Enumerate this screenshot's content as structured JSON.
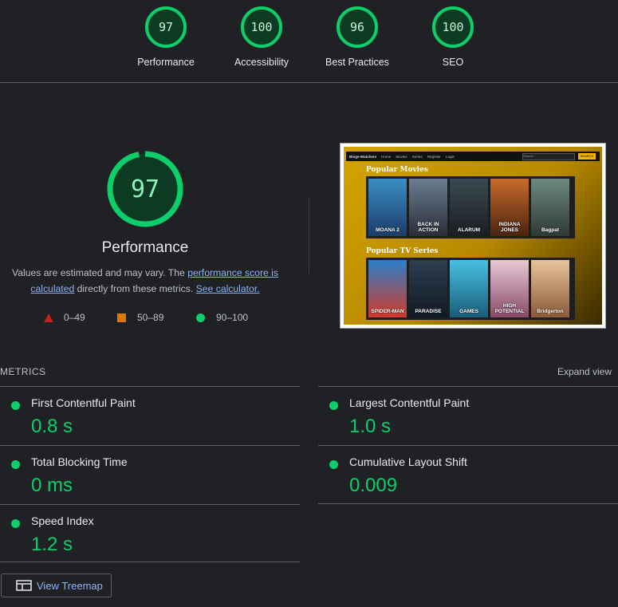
{
  "scores": [
    {
      "value": "97",
      "label": "Performance"
    },
    {
      "value": "100",
      "label": "Accessibility"
    },
    {
      "value": "96",
      "label": "Best Practices"
    },
    {
      "value": "100",
      "label": "SEO"
    }
  ],
  "performance": {
    "score": "97",
    "score_fraction": 0.97,
    "title": "Performance",
    "desc_part1": "Values are estimated and may vary. The ",
    "desc_link1": "performance score is calculated",
    "desc_part2": " directly from these metrics. ",
    "desc_link2": "See calculator."
  },
  "legend": {
    "fail": "0–49",
    "average": "50–89",
    "pass": "90–100"
  },
  "screenshot": {
    "brand": "Binge-Watchers",
    "nav_links": [
      "Home",
      "Movies",
      "Series",
      "Register",
      "Login"
    ],
    "search_placeholder": "Search...",
    "search_button": "SEARCH",
    "movies_heading": "Popular Movies",
    "series_heading": "Popular TV Series",
    "movie_titles": [
      "MOANA 2",
      "BACK IN ACTION",
      "ALARUM",
      "INDIANA JONES",
      "Bagpat"
    ],
    "series_titles": [
      "SPIDER-MAN",
      "PARADISE",
      "GAMES",
      "HIGH POTENTIAL",
      "Bridgerton"
    ]
  },
  "metrics": {
    "section_label": "METRICS",
    "expand_label": "Expand view",
    "fcp": {
      "name": "First Contentful Paint",
      "value": "0.8 s"
    },
    "lcp": {
      "name": "Largest Contentful Paint",
      "value": "1.0 s"
    },
    "tbt": {
      "name": "Total Blocking Time",
      "value": "0 ms"
    },
    "cls": {
      "name": "Cumulative Layout Shift",
      "value": "0.009"
    },
    "si": {
      "name": "Speed Index",
      "value": "1.2 s"
    }
  },
  "treemap_button": "View Treemap",
  "colors": {
    "pass": "#0cce6b",
    "average": "#e37400",
    "fail": "#c5221f",
    "link": "#8ab4f8"
  }
}
